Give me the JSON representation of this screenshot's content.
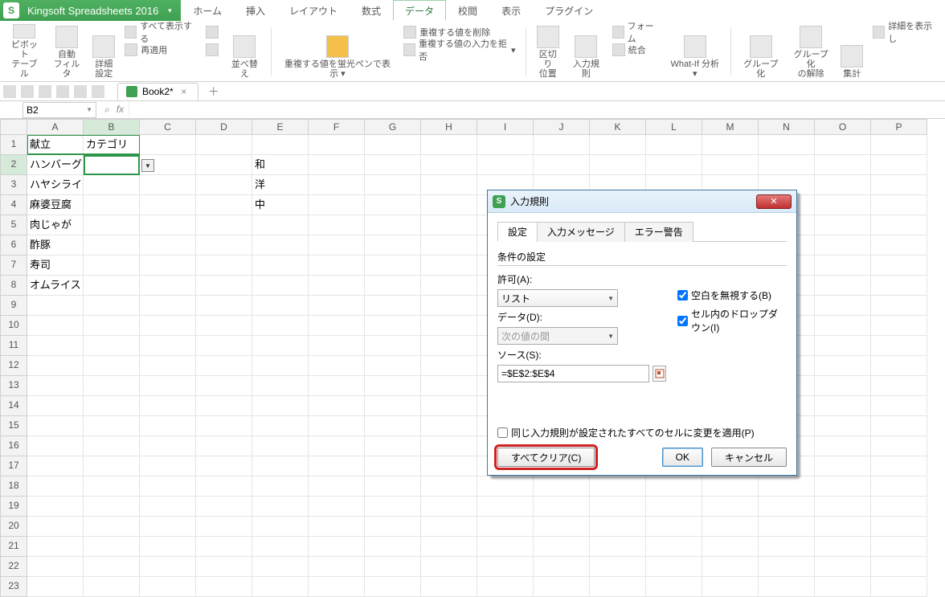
{
  "app": {
    "title": "Kingsoft Spreadsheets 2016"
  },
  "menu": {
    "tabs": [
      "ホーム",
      "挿入",
      "レイアウト",
      "数式",
      "データ",
      "校閲",
      "表示",
      "プラグイン"
    ],
    "active_index": 4
  },
  "ribbon": {
    "pivot": "ピボット\nテーブル",
    "autofilter": "自動\nフィルタ",
    "detail": "詳細\n設定",
    "showall": "すべて表示する",
    "reapply": "再適用",
    "sort": "並べ替え",
    "highlightdup": "重複する値を蛍光ペンで表示",
    "removedup": "重複する値を削除",
    "rejectdup": "重複する値の入力を拒否",
    "splitpos": "区切り\n位置",
    "datavalidation": "入力規則",
    "form": "フォーム",
    "consolidate": "統合",
    "whatif": "What-If 分析",
    "group": "グループ化",
    "ungroup": "グループ化\nの解除",
    "subtotal": "集計",
    "showdetail": "詳細を表示し"
  },
  "doc": {
    "name": "Book2*"
  },
  "namebox": {
    "ref": "B2"
  },
  "columns": [
    "A",
    "B",
    "C",
    "D",
    "E",
    "F",
    "G",
    "H",
    "I",
    "J",
    "K",
    "L",
    "M",
    "N",
    "O",
    "P"
  ],
  "cells": {
    "A1": "献立",
    "B1": "カテゴリ",
    "A2": "ハンバーグ",
    "E2": "和",
    "A3": "ハヤシライス",
    "E3": "洋",
    "A4": "麻婆豆腐",
    "E4": "中",
    "A5": "肉じゃが",
    "A6": "酢豚",
    "A7": "寿司",
    "A8": "オムライス"
  },
  "dialog": {
    "title": "入力規則",
    "tabs": {
      "settings": "設定",
      "input": "入力メッセージ",
      "error": "エラー警告"
    },
    "cond_label": "条件の設定",
    "allow_label": "許可(A):",
    "allow_value": "リスト",
    "ignoreblank": "空白を無視する(B)",
    "incell": "セル内のドロップダウン(I)",
    "data_label": "データ(D):",
    "data_value": "次の値の間",
    "source_label": "ソース(S):",
    "source_value": "=$E$2:$E$4",
    "applysame": "同じ入力規則が設定されたすべてのセルに変更を適用(P)",
    "clear": "すべてクリア(C)",
    "ok": "OK",
    "cancel": "キャンセル"
  }
}
